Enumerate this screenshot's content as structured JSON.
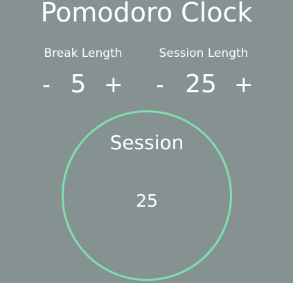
{
  "app": {
    "title": "Pomodoro Clock"
  },
  "break_control": {
    "label": "Break Length",
    "decrement_label": "-",
    "value": "5",
    "increment_label": "+"
  },
  "session_control": {
    "label": "Session Length",
    "decrement_label": "-",
    "value": "25",
    "increment_label": "+"
  },
  "clock": {
    "label": "Session",
    "time": "25",
    "ring_color": "#7fe0ae"
  },
  "colors": {
    "background": "#869291",
    "text": "#ffffff",
    "accent": "#7fe0ae"
  }
}
